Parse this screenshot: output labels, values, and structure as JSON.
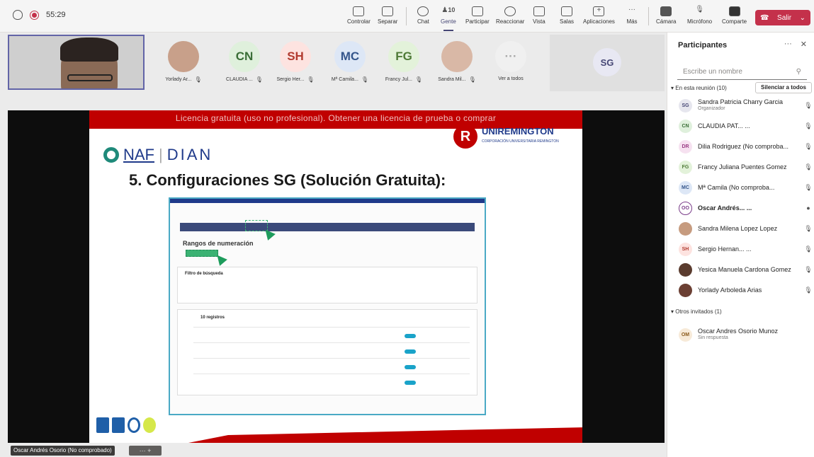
{
  "meeting": {
    "timer": "55:29"
  },
  "toolbar": {
    "controlar": "Controlar",
    "separar": "Separar",
    "chat": "Chat",
    "gente": "Gente",
    "gente_count": "10",
    "participar": "Participar",
    "reaccionar": "Reaccionar",
    "vista": "Vista",
    "salas": "Salas",
    "aplicaciones": "Aplicaciones",
    "mas": "Más",
    "camara": "Cámara",
    "microfono": "Micrófono",
    "comparte": "Comparte",
    "salir": "Salir"
  },
  "gallery": [
    {
      "initials": "",
      "name": "Yorlady Ar...",
      "bg": "#c8a08a"
    },
    {
      "initials": "CN",
      "name": "CLAUDIA ...",
      "bg": "#dff0dc",
      "fg": "#3a6e37"
    },
    {
      "initials": "SH",
      "name": "Sergio Her...",
      "bg": "#fde3e0",
      "fg": "#b23b30"
    },
    {
      "initials": "MC",
      "name": "Mª Camila...",
      "bg": "#dde7f6",
      "fg": "#34558b"
    },
    {
      "initials": "FG",
      "name": "Francy Jul...",
      "bg": "#e3f2da",
      "fg": "#4e7a37"
    },
    {
      "initials": "",
      "name": "Sandra Mil...",
      "bg": "#d9b8a6"
    },
    {
      "initials": "···",
      "name": "Ver a todos",
      "bg": "#f0f0f0",
      "fg": "#aaa"
    }
  ],
  "spotlight_tile": {
    "initials": "SG"
  },
  "slide": {
    "license": "Licencia gratuita (uso no profesional). Obtener una licencia de prueba o comprar",
    "uni_name": "UNIREMINGTON",
    "uni_sub": "CORPORACIÓN UNIVERSITARIA REMINGTON",
    "naf": "NAF",
    "dian": "DIAN",
    "title": "5. Configuraciones SG (Solución Gratuita):",
    "inner_heading": "Rangos de numeración",
    "inner_filter": "Filtro de búsqueda",
    "inner_count": "10 registros"
  },
  "bottom": {
    "name_chip": "Oscar Andrés Osorio (No comprobado)",
    "chip_controls": "⋯ +"
  },
  "panel": {
    "title": "Participantes",
    "search_placeholder": "Escribe un nombre",
    "in_meeting": "En esta reunión (10)",
    "mute_all": "Silenciar a todos",
    "others": "Otros invitados (1)",
    "people": [
      {
        "initials": "SG",
        "name": "Sandra Patricia Charry Garcia",
        "role": "Organizador",
        "bg": "#e6e6ee",
        "fg": "#464775"
      },
      {
        "initials": "CN",
        "name": "CLAUDIA PAT... ...",
        "role": "",
        "bg": "#dff0dc",
        "fg": "#3a6e37"
      },
      {
        "initials": "DR",
        "name": "Dilia Rodriguez (No comproba...",
        "role": "",
        "bg": "#f6e1f0",
        "fg": "#9a3b84"
      },
      {
        "initials": "FG",
        "name": "Francy Juliana Puentes Gomez",
        "role": "",
        "bg": "#e3f2da",
        "fg": "#4e7a37"
      },
      {
        "initials": "MC",
        "name": "Mª Camila (No comproba...",
        "role": "",
        "bg": "#dde7f6",
        "fg": "#34558b"
      },
      {
        "initials": "OO",
        "name": "Oscar Andrés... ...",
        "role": "",
        "bg": "#f3e3f5",
        "fg": "#7b3d8a"
      },
      {
        "initials": "",
        "name": "Sandra Milena Lopez Lopez",
        "role": "",
        "bg": "#c69b7f"
      },
      {
        "initials": "SH",
        "name": "Sergio Hernan... ...",
        "role": "",
        "bg": "#fde3e0",
        "fg": "#b23b30"
      },
      {
        "initials": "",
        "name": "Yesica Manuela Cardona Gomez",
        "role": "",
        "bg": "#5a3b2e"
      },
      {
        "initials": "",
        "name": "Yorlady Arboleda Arias",
        "role": "",
        "bg": "#6b3f33"
      }
    ],
    "guest": {
      "initials": "OM",
      "name": "Oscar Andres Osorio Munoz",
      "status": "Sin respuesta",
      "bg": "#f7ead8",
      "fg": "#8a5a1c"
    }
  }
}
